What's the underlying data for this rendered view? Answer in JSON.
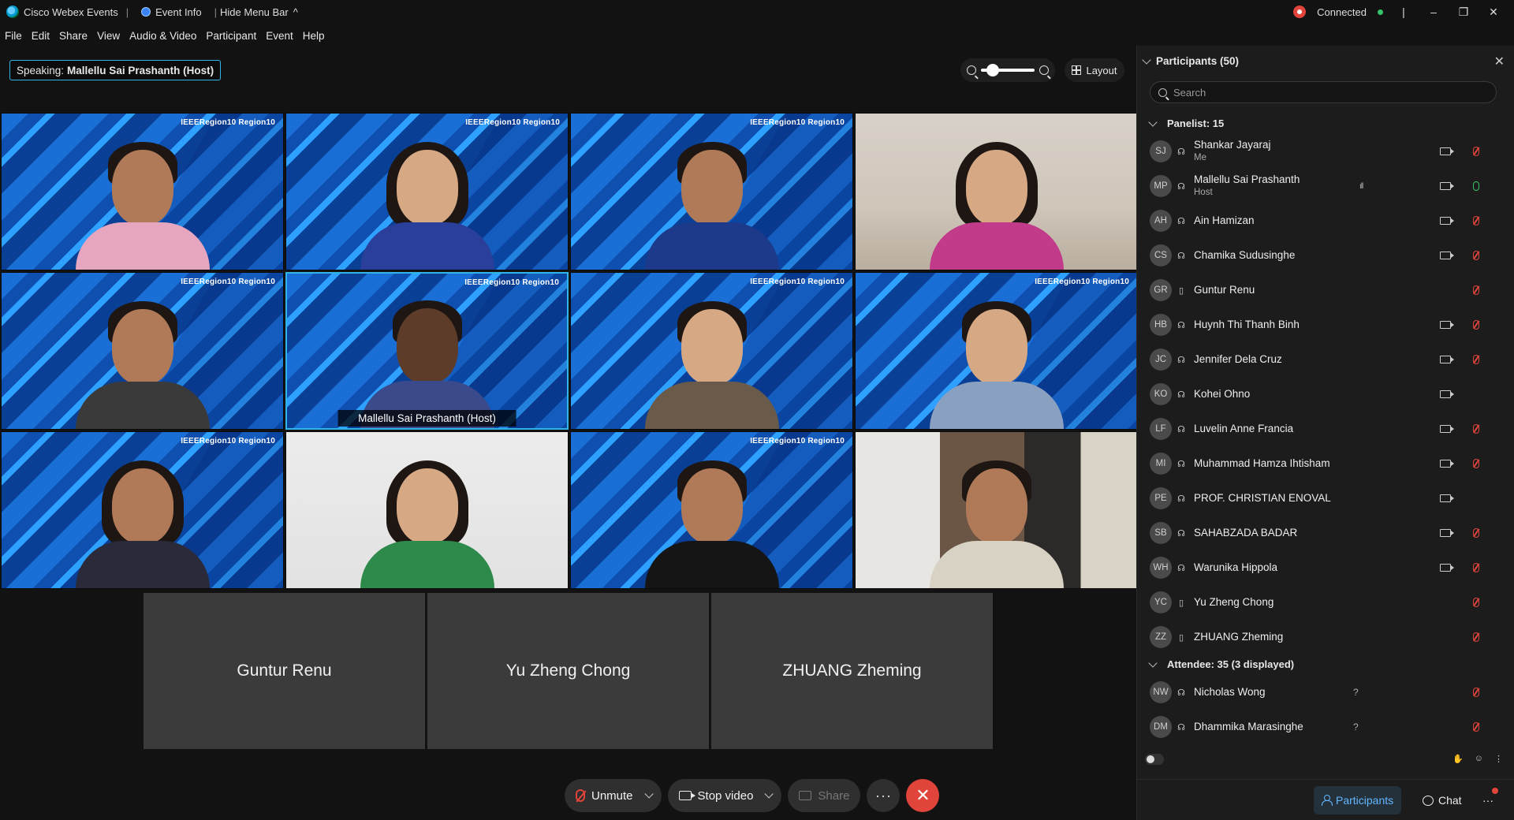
{
  "window": {
    "app_title": "Cisco Webex Events",
    "event_info": "Event Info",
    "hide_menu_bar": "Hide Menu Bar",
    "status": "Connected"
  },
  "menu": [
    "File",
    "Edit",
    "Share",
    "View",
    "Audio & Video",
    "Participant",
    "Event",
    "Help"
  ],
  "speaking": {
    "label": "Speaking:",
    "name": "Mallellu Sai Prashanth (Host)"
  },
  "layout_label": "Layout",
  "zoom_level": 0.1,
  "video_tiles": [
    {
      "bg": "ieee",
      "skin": "med",
      "hair": "short",
      "shirt": "#e7a6c0",
      "logo": "IEEERegion10  Region10"
    },
    {
      "bg": "ieee",
      "skin": "light",
      "hair": "long",
      "shirt": "#2a3f9a",
      "logo": "IEEERegion10  Region10"
    },
    {
      "bg": "ieee",
      "skin": "med",
      "hair": "short",
      "shirt": "#1d3a8a",
      "logo": "IEEERegion10  Region10"
    },
    {
      "bg": "room",
      "skin": "light",
      "hair": "long",
      "shirt": "#c23a8a",
      "logo": ""
    },
    {
      "bg": "ieee",
      "skin": "med",
      "hair": "short",
      "shirt": "#3a3a3a",
      "logo": "IEEERegion10  Region10"
    },
    {
      "bg": "ieee",
      "skin": "dark",
      "hair": "short",
      "shirt": "#3a4a8a",
      "logo": "IEEERegion10  Region10",
      "label": "Mallellu Sai Prashanth  (Host)",
      "active": true
    },
    {
      "bg": "ieee",
      "skin": "light",
      "hair": "short",
      "shirt": "#6a5a4a",
      "logo": "IEEERegion10  Region10"
    },
    {
      "bg": "ieee",
      "skin": "light",
      "hair": "short",
      "shirt": "#8aa0c0",
      "logo": "IEEERegion10  Region10"
    },
    {
      "bg": "ieee",
      "skin": "med",
      "hair": "long",
      "shirt": "#2a2a3a",
      "logo": "IEEERegion10  Region10"
    },
    {
      "bg": "wall",
      "skin": "light",
      "hair": "long",
      "shirt": "#2e8a4a",
      "logo": ""
    },
    {
      "bg": "ieee",
      "skin": "med",
      "hair": "short",
      "shirt": "#151515",
      "logo": "IEEERegion10  Region10"
    },
    {
      "bg": "office",
      "skin": "med",
      "hair": "short",
      "shirt": "#d8d2c4",
      "logo": ""
    }
  ],
  "no_video_tiles": [
    "Guntur Renu",
    "Yu Zheng Chong",
    "ZHUANG Zheming"
  ],
  "controls": {
    "unmute": "Unmute",
    "stop_video": "Stop video",
    "share": "Share"
  },
  "panel": {
    "title": "Participants (50)",
    "search_placeholder": "Search",
    "panelist_header": "Panelist: 15",
    "attendee_header": "Attendee: 35 (3 displayed)",
    "tab_participants": "Participants",
    "tab_chat": "Chat"
  },
  "panelists": [
    {
      "initials": "SJ",
      "name": "Shankar Jayaraj",
      "sub": "Me",
      "video": true,
      "mic": "muted",
      "device": "headset"
    },
    {
      "initials": "MP",
      "name": "Mallellu Sai Prashanth",
      "sub": "Host",
      "video": true,
      "mic": "on",
      "device": "headset",
      "levels": "ıll"
    },
    {
      "initials": "AH",
      "name": "Ain Hamizan",
      "sub": "",
      "video": true,
      "mic": "muted",
      "device": "headset"
    },
    {
      "initials": "CS",
      "name": "Chamika Sudusinghe",
      "sub": "",
      "video": true,
      "mic": "muted",
      "device": "headset"
    },
    {
      "initials": "GR",
      "name": "Guntur Renu",
      "sub": "",
      "video": false,
      "mic": "muted",
      "device": "phone"
    },
    {
      "initials": "HB",
      "name": "Huynh Thi Thanh Binh",
      "sub": "",
      "video": true,
      "mic": "muted",
      "device": "headset"
    },
    {
      "initials": "JC",
      "name": "Jennifer Dela Cruz",
      "sub": "",
      "video": true,
      "mic": "muted",
      "device": "headset"
    },
    {
      "initials": "KO",
      "name": "Kohei Ohno",
      "sub": "",
      "video": true,
      "mic": "none",
      "device": "headset"
    },
    {
      "initials": "LF",
      "name": "Luvelin Anne Francia",
      "sub": "",
      "video": true,
      "mic": "muted",
      "device": "headset"
    },
    {
      "initials": "MI",
      "name": "Muhammad Hamza Ihtisham",
      "sub": "",
      "video": true,
      "mic": "muted",
      "device": "headset"
    },
    {
      "initials": "PE",
      "name": "PROF. CHRISTIAN ENOVAL",
      "sub": "",
      "video": true,
      "mic": "none",
      "device": "headset"
    },
    {
      "initials": "SB",
      "name": "SAHABZADA BADAR",
      "sub": "",
      "video": true,
      "mic": "muted",
      "device": "headset"
    },
    {
      "initials": "WH",
      "name": "Warunika Hippola",
      "sub": "",
      "video": true,
      "mic": "muted",
      "device": "headset"
    },
    {
      "initials": "YC",
      "name": "Yu Zheng Chong",
      "sub": "",
      "video": false,
      "mic": "muted",
      "device": "phone"
    },
    {
      "initials": "ZZ",
      "name": "ZHUANG Zheming",
      "sub": "",
      "video": false,
      "mic": "muted",
      "device": "phone"
    }
  ],
  "attendees": [
    {
      "initials": "NW",
      "name": "Nicholas Wong",
      "status": "?",
      "mic": "muted",
      "device": "headset"
    },
    {
      "initials": "DM",
      "name": "Dhammika Marasinghe",
      "status": "?",
      "mic": "muted",
      "device": "headset"
    }
  ],
  "colors": {
    "accent": "#2fb5e8",
    "leave": "#e0443a",
    "muted": "#e0443a",
    "unmuted": "#36c46a",
    "tab_active": "#63b7ff"
  }
}
